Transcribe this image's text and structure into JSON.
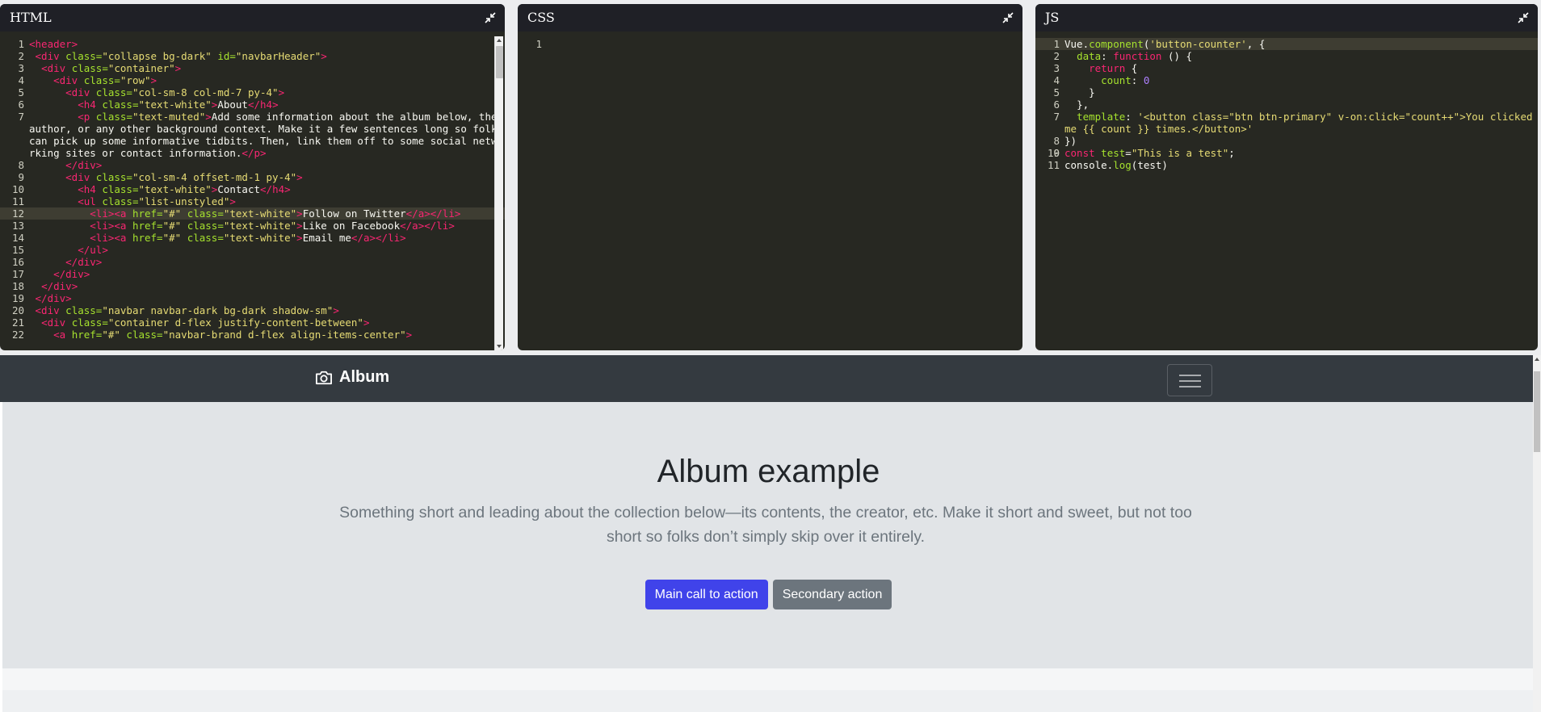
{
  "panels": {
    "html_title": "HTML",
    "css_title": "CSS",
    "js_title": "JS"
  },
  "html_code": [
    {
      "n": "1",
      "parts": [
        [
          "tag",
          "<header>"
        ]
      ]
    },
    {
      "n": "2",
      "parts": [
        [
          "id",
          " "
        ],
        [
          "tag",
          "<div "
        ],
        [
          "attr",
          "class="
        ],
        [
          "str",
          "\"collapse bg-dark\""
        ],
        [
          "attr",
          " id="
        ],
        [
          "str",
          "\"navbarHeader\""
        ],
        [
          "tag",
          ">"
        ]
      ]
    },
    {
      "n": "3",
      "parts": [
        [
          "id",
          "  "
        ],
        [
          "tag",
          "<div "
        ],
        [
          "attr",
          "class="
        ],
        [
          "str",
          "\"container\""
        ],
        [
          "tag",
          ">"
        ]
      ]
    },
    {
      "n": "4",
      "parts": [
        [
          "id",
          "    "
        ],
        [
          "tag",
          "<div "
        ],
        [
          "attr",
          "class="
        ],
        [
          "str",
          "\"row\""
        ],
        [
          "tag",
          ">"
        ]
      ]
    },
    {
      "n": "5",
      "parts": [
        [
          "id",
          "      "
        ],
        [
          "tag",
          "<div "
        ],
        [
          "attr",
          "class="
        ],
        [
          "str",
          "\"col-sm-8 col-md-7 py-4\""
        ],
        [
          "tag",
          ">"
        ]
      ]
    },
    {
      "n": "6",
      "parts": [
        [
          "id",
          "        "
        ],
        [
          "tag",
          "<h4 "
        ],
        [
          "attr",
          "class="
        ],
        [
          "str",
          "\"text-white\""
        ],
        [
          "tag",
          ">"
        ],
        [
          "id",
          "About"
        ],
        [
          "tag",
          "</h4>"
        ]
      ]
    },
    {
      "n": "7",
      "parts": [
        [
          "id",
          "        "
        ],
        [
          "tag",
          "<p "
        ],
        [
          "attr",
          "class="
        ],
        [
          "str",
          "\"text-muted\""
        ],
        [
          "tag",
          ">"
        ],
        [
          "id",
          "Add some information about the album below, the author, or any other background context. Make it a few sentences long so folks can pick up some informative tidbits. Then, link them off to some social networking sites or contact information."
        ],
        [
          "tag",
          "</p>"
        ]
      ]
    },
    {
      "n": "8",
      "parts": [
        [
          "id",
          "      "
        ],
        [
          "tag",
          "</div>"
        ]
      ]
    },
    {
      "n": "9",
      "parts": [
        [
          "id",
          "      "
        ],
        [
          "tag",
          "<div "
        ],
        [
          "attr",
          "class="
        ],
        [
          "str",
          "\"col-sm-4 offset-md-1 py-4\""
        ],
        [
          "tag",
          ">"
        ]
      ]
    },
    {
      "n": "10",
      "parts": [
        [
          "id",
          "        "
        ],
        [
          "tag",
          "<h4 "
        ],
        [
          "attr",
          "class="
        ],
        [
          "str",
          "\"text-white\""
        ],
        [
          "tag",
          ">"
        ],
        [
          "id",
          "Contact"
        ],
        [
          "tag",
          "</h4>"
        ]
      ]
    },
    {
      "n": "11",
      "parts": [
        [
          "id",
          "        "
        ],
        [
          "tag",
          "<ul "
        ],
        [
          "attr",
          "class="
        ],
        [
          "str",
          "\"list-unstyled\""
        ],
        [
          "tag",
          ">"
        ]
      ]
    },
    {
      "n": "12",
      "hl": true,
      "parts": [
        [
          "id",
          "          "
        ],
        [
          "tag",
          "<li><a "
        ],
        [
          "attr",
          "href="
        ],
        [
          "str",
          "\"#\""
        ],
        [
          "attr",
          " class="
        ],
        [
          "str",
          "\"text-white\""
        ],
        [
          "tag",
          ">"
        ],
        [
          "id",
          "Follow on Twitter"
        ],
        [
          "tag",
          "</a>"
        ],
        [
          "tag",
          "</li>"
        ]
      ]
    },
    {
      "n": "13",
      "parts": [
        [
          "id",
          "          "
        ],
        [
          "tag",
          "<li><a "
        ],
        [
          "attr",
          "href="
        ],
        [
          "str",
          "\"#\""
        ],
        [
          "attr",
          " class="
        ],
        [
          "str",
          "\"text-white\""
        ],
        [
          "tag",
          ">"
        ],
        [
          "id",
          "Like on Facebook"
        ],
        [
          "tag",
          "</a></li>"
        ]
      ]
    },
    {
      "n": "14",
      "parts": [
        [
          "id",
          "          "
        ],
        [
          "tag",
          "<li><a "
        ],
        [
          "attr",
          "href="
        ],
        [
          "str",
          "\"#\""
        ],
        [
          "attr",
          " class="
        ],
        [
          "str",
          "\"text-white\""
        ],
        [
          "tag",
          ">"
        ],
        [
          "id",
          "Email me"
        ],
        [
          "tag",
          "</a></li>"
        ]
      ]
    },
    {
      "n": "15",
      "parts": [
        [
          "id",
          "        "
        ],
        [
          "tag",
          "</ul>"
        ]
      ]
    },
    {
      "n": "16",
      "parts": [
        [
          "id",
          "      "
        ],
        [
          "tag",
          "</div>"
        ]
      ]
    },
    {
      "n": "17",
      "parts": [
        [
          "id",
          "    "
        ],
        [
          "tag",
          "</div>"
        ]
      ]
    },
    {
      "n": "18",
      "parts": [
        [
          "id",
          "  "
        ],
        [
          "tag",
          "</div>"
        ]
      ]
    },
    {
      "n": "19",
      "parts": [
        [
          "id",
          " "
        ],
        [
          "tag",
          "</div>"
        ]
      ]
    },
    {
      "n": "20",
      "parts": [
        [
          "id",
          " "
        ],
        [
          "tag",
          "<div "
        ],
        [
          "attr",
          "class="
        ],
        [
          "str",
          "\"navbar navbar-dark bg-dark shadow-sm\""
        ],
        [
          "tag",
          ">"
        ]
      ]
    },
    {
      "n": "21",
      "parts": [
        [
          "id",
          "  "
        ],
        [
          "tag",
          "<div "
        ],
        [
          "attr",
          "class="
        ],
        [
          "str",
          "\"container d-flex justify-content-between\""
        ],
        [
          "tag",
          ">"
        ]
      ]
    },
    {
      "n": "22",
      "parts": [
        [
          "id",
          "    "
        ],
        [
          "tag",
          "<a "
        ],
        [
          "attr",
          "href="
        ],
        [
          "str",
          "\"#\""
        ],
        [
          "attr",
          " class="
        ],
        [
          "str",
          "\"navbar-brand d-flex align-items-center\""
        ],
        [
          "tag",
          ">"
        ]
      ]
    }
  ],
  "css_code": [
    {
      "n": "1",
      "hl": true,
      "parts": [
        [
          "id",
          ""
        ]
      ]
    }
  ],
  "js_code": [
    {
      "n": "1",
      "hl": true,
      "parts": [
        [
          "id",
          "Vue."
        ],
        [
          "fn",
          "component"
        ],
        [
          "id",
          "("
        ],
        [
          "str",
          "'button-counter'"
        ],
        [
          "id",
          ", {"
        ]
      ]
    },
    {
      "n": "2",
      "parts": [
        [
          "id",
          "  "
        ],
        [
          "prop",
          "data"
        ],
        [
          "id",
          ": "
        ],
        [
          "kw",
          "function"
        ],
        [
          "id",
          " () {"
        ]
      ]
    },
    {
      "n": "3",
      "parts": [
        [
          "id",
          "    "
        ],
        [
          "kw",
          "return"
        ],
        [
          "id",
          " {"
        ]
      ]
    },
    {
      "n": "4",
      "parts": [
        [
          "id",
          "      "
        ],
        [
          "prop",
          "count"
        ],
        [
          "id",
          ": "
        ],
        [
          "num",
          "0"
        ]
      ]
    },
    {
      "n": "5",
      "parts": [
        [
          "id",
          "    }"
        ]
      ]
    },
    {
      "n": "6",
      "parts": [
        [
          "id",
          "  },"
        ]
      ]
    },
    {
      "n": "7",
      "parts": [
        [
          "id",
          "  "
        ],
        [
          "prop",
          "template"
        ],
        [
          "id",
          ": "
        ],
        [
          "str",
          "'<button class=\"btn btn-primary\" v-on:click=\"count++\">You clicked me {{ count }} times.</button>'"
        ]
      ]
    },
    {
      "n": "8",
      "parts": [
        [
          "id",
          "})"
        ]
      ]
    },
    {
      "n": "9",
      "parts": [
        [
          "id",
          ""
        ]
      ]
    },
    {
      "n": "10",
      "parts": [
        [
          "kw",
          "const"
        ],
        [
          "id",
          " "
        ],
        [
          "prop",
          "test"
        ],
        [
          "id",
          "="
        ],
        [
          "str",
          "\"This is a test\""
        ],
        [
          "id",
          ";"
        ]
      ]
    },
    {
      "n": "11",
      "parts": [
        [
          "id",
          "console."
        ],
        [
          "fn",
          "log"
        ],
        [
          "id",
          "(test)"
        ]
      ]
    }
  ],
  "preview": {
    "brand": "Album",
    "brand_icon": "camera-icon",
    "toggler_icon": "hamburger-icon",
    "heading": "Album example",
    "lead": "Something short and leading about the collection below—its contents, the creator, etc. Make it short and sweet, but not too short so folks don’t simply skip over it entirely.",
    "primary_button": "Main call to action",
    "secondary_button": "Secondary action"
  },
  "colors": {
    "editor_bg": "#272822",
    "navbar_bg": "#343a40",
    "primary": "#4043ea",
    "secondary": "#6c757d"
  }
}
